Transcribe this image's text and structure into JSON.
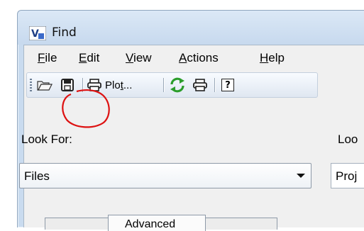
{
  "window": {
    "title": "Find",
    "app_icon_letter": "V"
  },
  "menu": {
    "items": [
      {
        "label": "File",
        "mnemonic": "F",
        "rest": "ile"
      },
      {
        "label": "Edit",
        "mnemonic": "E",
        "rest": "dit"
      },
      {
        "label": "View",
        "mnemonic": "V",
        "rest": "iew"
      },
      {
        "label": "Actions",
        "mnemonic": "A",
        "rest": "ctions"
      },
      {
        "label": "Help",
        "mnemonic": "H",
        "rest": "elp"
      }
    ]
  },
  "toolbar": {
    "open_icon": "folder-open-icon",
    "save_icon": "floppy-disk-icon",
    "plot_label_prefix": "Plo",
    "plot_label_mnemonic": "t",
    "plot_label_suffix": "...",
    "plot_icon": "printer-icon",
    "refresh_icon": "refresh-icon",
    "print_icon": "printer-icon",
    "help_label": "?",
    "accent_color": "#dd1111"
  },
  "form": {
    "look_for_label": "Look For:",
    "look_for_value": "Files",
    "look_in_label": "Loo",
    "look_in_value": "Proj"
  },
  "tabs": {
    "active_partial_label": "Advanced"
  }
}
